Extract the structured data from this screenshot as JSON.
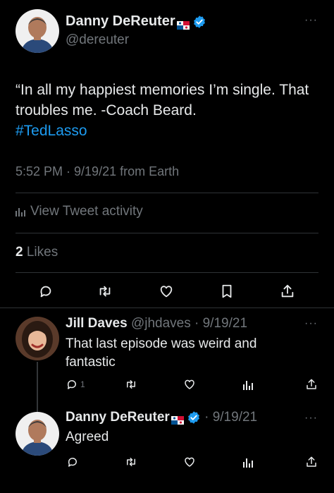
{
  "main_tweet": {
    "display_name": "Danny DeReuter",
    "handle": "@dereuter",
    "text": "“In all my happiest memories I’m single. That troubles me. -Coach Beard.",
    "hashtag": "#TedLasso",
    "time": "5:52 PM · 9/19/21 from Earth",
    "activity_label": "View Tweet activity",
    "likes_count": "2",
    "likes_label": "Likes",
    "more_label": "···"
  },
  "reply_1": {
    "display_name": "Jill Daves",
    "handle_date": "@jhdaves · 9/19/21",
    "text": "That last episode was weird and fantastic",
    "reply_count": "1",
    "more_label": "···"
  },
  "reply_2": {
    "display_name": "Danny DeReuter",
    "date": "· 9/19/21",
    "text": "Agreed",
    "more_label": "···"
  },
  "colors": {
    "background": "#000000",
    "text": "#e7e9ea",
    "muted": "#71767b",
    "accent": "#1d9bf0",
    "divider": "#2f3336"
  },
  "icons": [
    "reply-icon",
    "retweet-icon",
    "like-icon",
    "bookmark-icon",
    "share-icon",
    "analytics-icon",
    "verified-icon",
    "panama-flag-icon",
    "more-icon"
  ]
}
